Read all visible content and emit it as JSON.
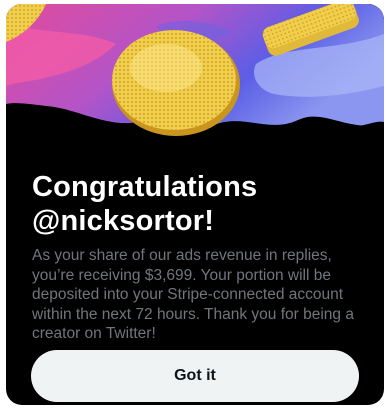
{
  "dialog": {
    "title_line1": "Congratulations",
    "title_line2": "@nicksortor!",
    "message": "As your share of our ads revenue in replies, you’re receiving $3,699. Your portion will be deposited into your Stripe-connected account within the next 72 hours. Thank you for being a creator on Twitter!",
    "button_label": "Got it"
  },
  "colors": {
    "background": "#000000",
    "title": "#ffffff",
    "message": "#71767b",
    "button_bg": "#eff3f4",
    "button_text": "#0f1419",
    "coin": "#f2cf4a",
    "hero_pink": "#e84ea5",
    "hero_blue": "#5b5ee6"
  },
  "icons": {
    "hero_art": "gold-coins-illustration"
  }
}
